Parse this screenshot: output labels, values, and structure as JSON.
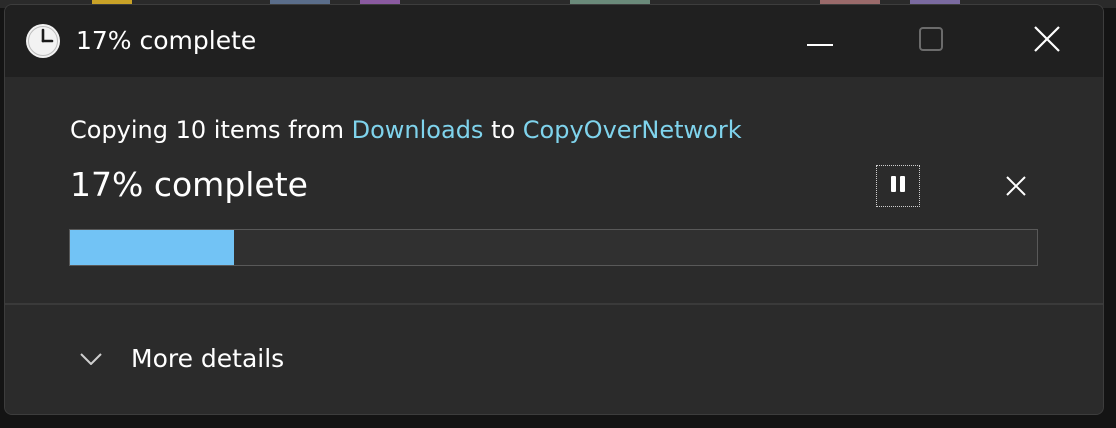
{
  "window": {
    "title": "17% complete",
    "icon": "clock-icon",
    "controls": {
      "minimize_icon": "minimize-icon",
      "maximize_icon": "maximize-icon",
      "close_icon": "close-icon"
    }
  },
  "operation": {
    "prefix": "Copying 10 items from ",
    "source": "Downloads",
    "connector": " to ",
    "destination": "CopyOverNetwork",
    "status": "17% complete",
    "progress_percent": 17,
    "pause_icon": "pause-icon",
    "cancel_icon": "close-icon"
  },
  "details": {
    "label": "More details",
    "icon": "chevron-down-icon"
  },
  "colors": {
    "accent": "#72c3f5",
    "link": "#7fd3ec",
    "titlebar": "#202020",
    "body": "#2b2b2b"
  }
}
